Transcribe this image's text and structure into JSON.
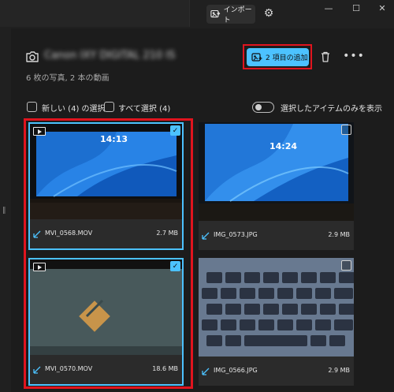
{
  "toolbar": {
    "import_label": "インポート"
  },
  "header": {
    "device_name": "Canon IXY DIGITAL 210 IS",
    "summary": "6 枚の写真, 2 本の動画",
    "add_button_label": "2 項目の追加"
  },
  "filters": {
    "select_new_label": "新しい (4) の選択",
    "select_all_label": "すべて選択 (4)",
    "show_selected_only_label": "選択したアイテムのみを表示"
  },
  "items": [
    {
      "name": "MVI_0568.MOV",
      "size": "2.7 MB",
      "type": "video",
      "selected": true,
      "clock": "14:13"
    },
    {
      "name": "IMG_0573.JPG",
      "size": "2.9 MB",
      "type": "photo",
      "selected": false,
      "clock": "14:24"
    },
    {
      "name": "MVI_0570.MOV",
      "size": "18.6 MB",
      "type": "video",
      "selected": true,
      "clock": ""
    },
    {
      "name": "IMG_0566.JPG",
      "size": "2.9 MB",
      "type": "photo",
      "selected": false,
      "clock": ""
    }
  ],
  "colors": {
    "accent": "#4cc2ff",
    "highlight": "#e0141e",
    "background": "#202020"
  },
  "icons": [
    "import-icon",
    "gear-icon",
    "minimize-icon",
    "maximize-icon",
    "close-icon",
    "camera-icon",
    "add-to-library-icon",
    "trash-icon",
    "more-icon",
    "video-icon",
    "checkmark-icon"
  ]
}
